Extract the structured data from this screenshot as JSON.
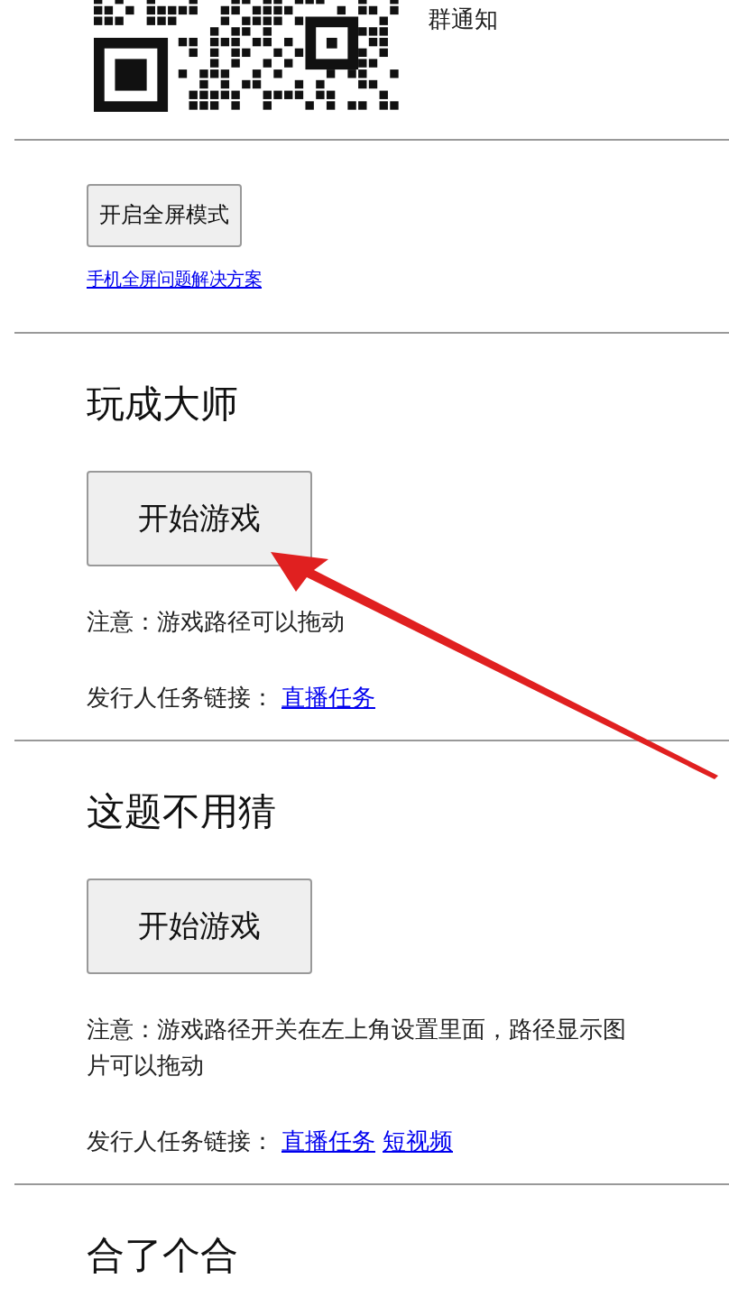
{
  "qr_caption": "群通知",
  "fullscreen": {
    "button": "开启全屏模式",
    "link": "手机全屏问题解决方案"
  },
  "games": [
    {
      "title": "玩成大师",
      "button": "开始游戏",
      "note": "注意：游戏路径可以拖动",
      "publisher_label": "发行人任务链接：",
      "links": [
        "直播任务"
      ]
    },
    {
      "title": "这题不用猜",
      "button": "开始游戏",
      "note": "注意：游戏路径开关在左上角设置里面，路径显示图片可以拖动",
      "publisher_label": "发行人任务链接：",
      "links": [
        "直播任务",
        "短视频"
      ]
    },
    {
      "title": "合了个合"
    }
  ]
}
